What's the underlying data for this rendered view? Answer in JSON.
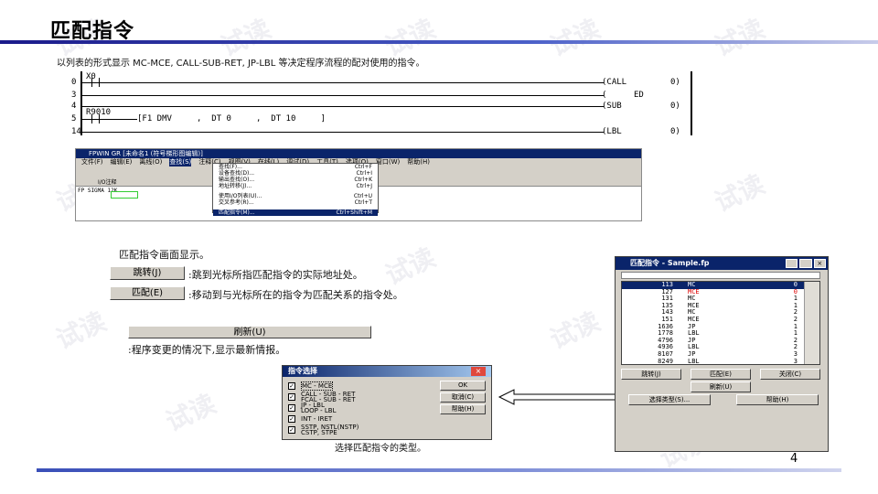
{
  "title": "匹配指令",
  "intro": "以列表的形式显示 MC-MCE, CALL-SUB-RET, JP-LBL 等决定程序流程的配对使用的指令。",
  "ladder": {
    "rows": [
      {
        "step": "0",
        "contact": "X0",
        "instr": "(CALL",
        "arg": "0)"
      },
      {
        "step": "3",
        "contact": "",
        "instr": "(",
        "arg": "ED"
      },
      {
        "step": "4",
        "contact": "",
        "instr": "(SUB",
        "arg": "0)"
      },
      {
        "step": "5",
        "contact": "R9010",
        "instr": "[F1 DMV     ,  DT 0     ,  DT 10     ]",
        "arg": ""
      },
      {
        "step": "14",
        "contact": "",
        "instr": "(LBL",
        "arg": "0)"
      }
    ]
  },
  "window": {
    "title": "FPWIN GR  [未命名1 (符号梯形图编辑)]",
    "menus": [
      "文件(F)",
      "编辑(E)",
      "离线(O)",
      "查找(S)",
      "注释(C)",
      "视图(V)",
      "在线(L)",
      "调试(D)",
      "工具(T)",
      "选项(O)",
      "窗口(W)",
      "帮助(H)"
    ],
    "status": "FP SIGMA 12K",
    "io_label": "I/O注释",
    "dropdown": [
      {
        "label": "查找(F)...",
        "key": "Ctrl+F"
      },
      {
        "label": "设备查找(D)...",
        "key": "Ctrl+I"
      },
      {
        "label": "输出查找(O)...",
        "key": "Ctrl+K"
      },
      {
        "label": "地址转移(J)...",
        "key": "Ctrl+J"
      },
      {
        "label": "使用I/O列表(U)...",
        "key": "Ctrl+U"
      },
      {
        "label": "交叉参考(R)...",
        "key": "Ctrl+T"
      },
      {
        "label": "匹配指令(M)...",
        "key": "Ctrl+Shift+M"
      }
    ]
  },
  "screen_desc": "匹配指令画面显示。",
  "jump_btn": "跳转(J)",
  "jump_desc": ":跳到光标所指匹配指令的实际地址处。",
  "match_btn": "匹配(E)",
  "match_desc": ":移动到与光标所在的指令为匹配关系的指令处。",
  "refresh_btn": "刷新(U)",
  "refresh_desc": ":程序变更的情况下,显示最新情报。",
  "select_dialog": {
    "title": "指令选择",
    "options": [
      "MC - MCE",
      "CALL - SUB - RET\nFCAL - SUB - RET",
      "JP - LBL\nLOOP - LBL",
      "INT - IRET",
      "SSTP, NSTL(NSTP)\nCSTP, STPE"
    ],
    "ok": "OK",
    "cancel": "取消(C)",
    "help": "帮助(H)",
    "caption": "选择匹配指令的类型。"
  },
  "match_dialog": {
    "title": "匹配指令 - Sample.fp",
    "rows": [
      [
        "113",
        "MC",
        "0"
      ],
      [
        "127",
        "MCE",
        "0"
      ],
      [
        "131",
        "MC",
        "1"
      ],
      [
        "135",
        "MCE",
        "1"
      ],
      [
        "143",
        "MC",
        "2"
      ],
      [
        "151",
        "MCE",
        "2"
      ],
      [
        "1636",
        "JP",
        "1"
      ],
      [
        "1778",
        "LBL",
        "1"
      ],
      [
        "4796",
        "JP",
        "2"
      ],
      [
        "4936",
        "LBL",
        "2"
      ],
      [
        "8107",
        "JP",
        "3"
      ],
      [
        "8249",
        "LBL",
        "3"
      ],
      [
        "11482",
        "JP",
        "4"
      ]
    ],
    "jump": "跳转(J)",
    "match": "匹配(E)",
    "close": "关闭(C)",
    "refresh": "刷新(U)",
    "select_type": "选择类型(S)...",
    "help": "帮助(H)"
  },
  "page_number": "4"
}
